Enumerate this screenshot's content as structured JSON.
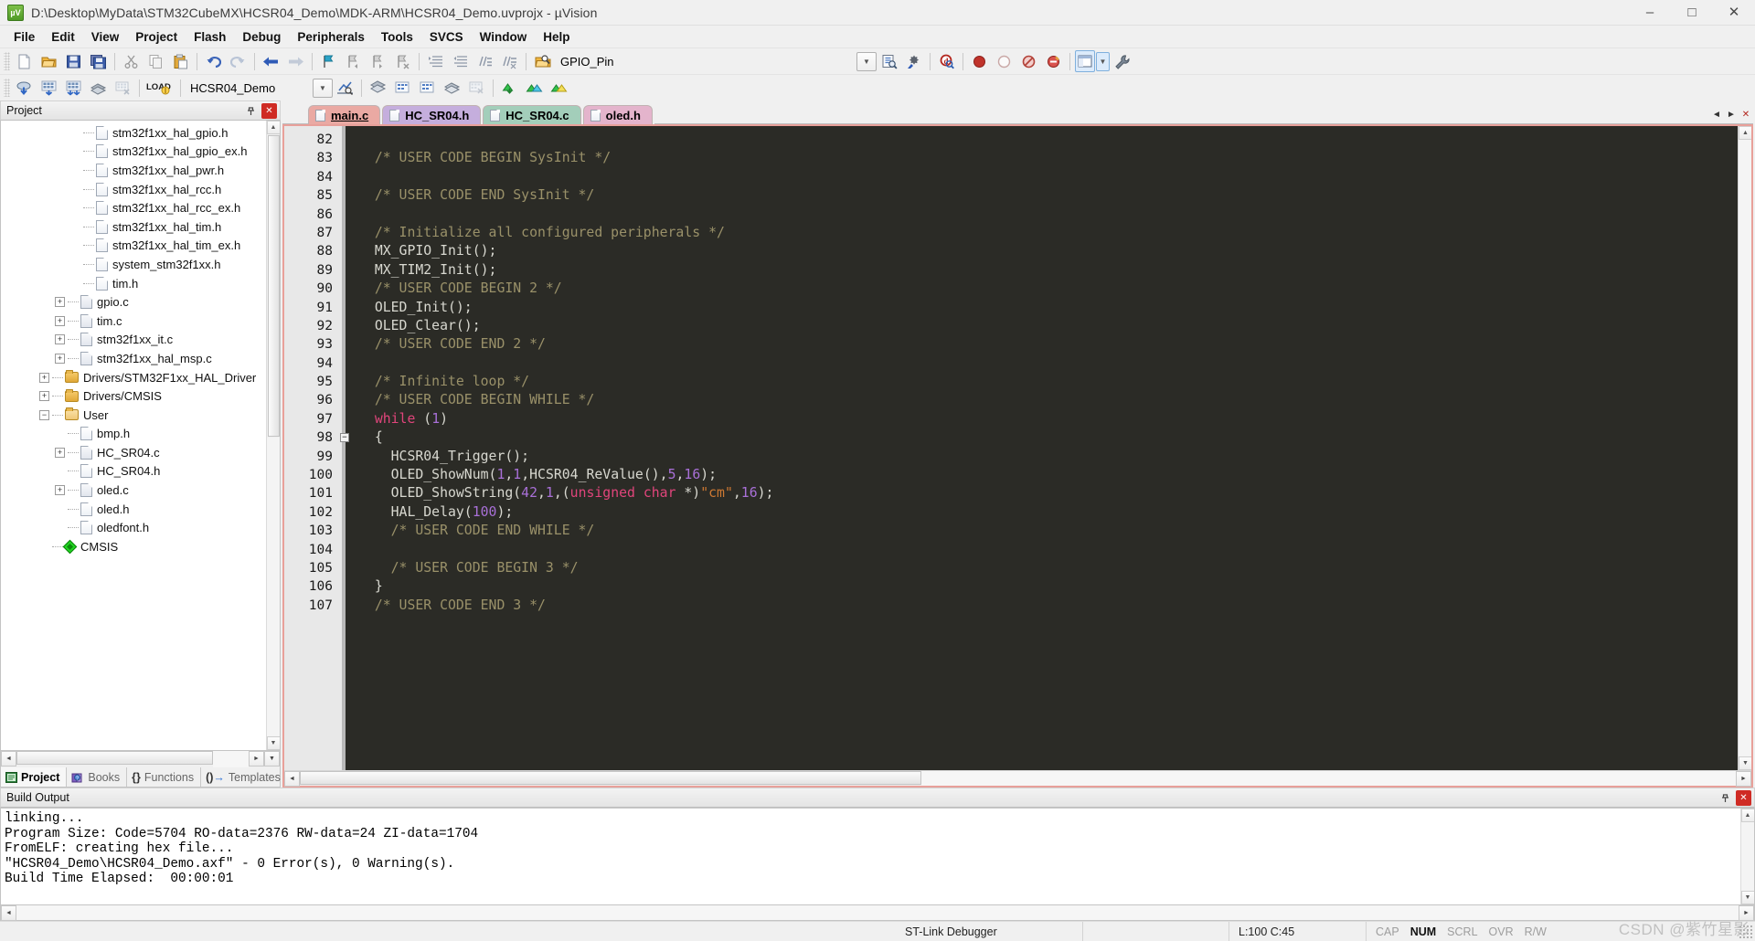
{
  "window": {
    "title": "D:\\Desktop\\MyData\\STM32CubeMX\\HCSR04_Demo\\MDK-ARM\\HCSR04_Demo.uvprojx - µVision",
    "app_icon_label": "µV",
    "minimize": "–",
    "maximize": "□",
    "close": "✕"
  },
  "menu": {
    "items": [
      "File",
      "Edit",
      "View",
      "Project",
      "Flash",
      "Debug",
      "Peripherals",
      "Tools",
      "SVCS",
      "Window",
      "Help"
    ]
  },
  "toolbar1": {
    "icons": [
      "new-file-icon",
      "open-file-icon",
      "save-icon",
      "save-all-icon",
      "cut-icon",
      "copy-icon",
      "paste-icon",
      "undo-icon",
      "redo-icon",
      "navigate-back-icon",
      "navigate-forward-icon",
      "bookmark-toggle-icon",
      "bookmark-prev-icon",
      "bookmark-next-icon",
      "bookmark-clear-icon",
      "indent-increase-icon",
      "indent-decrease-icon",
      "comment-icon",
      "uncomment-icon",
      "find-in-files-icon"
    ],
    "search_value": "GPIO_Pin",
    "search_placeholder": "",
    "right_icons": [
      "dropdown-arrow-icon",
      "browse-symbol-icon",
      "configure-icon",
      "debug-query-icon",
      "stop-icon",
      "circle-icon",
      "no-entry-icon",
      "warning-icon",
      "window-layout-icon",
      "layout-dropdown-icon",
      "configure-wrench-icon"
    ]
  },
  "toolbar2": {
    "icons": [
      "translate-icon",
      "build-target-icon",
      "rebuild-all-icon",
      "batch-build-icon",
      "stop-build-icon",
      "load-icon"
    ],
    "target_value": "HCSR04_Demo",
    "after_icons": [
      "target-options-icon",
      "manage-runtime-icon",
      "multi-project-icon",
      "book-icon",
      "insert-icon",
      "pack-installer-icon",
      "pack-green-icon",
      "pack-blue-icon",
      "pack-yellow-icon"
    ]
  },
  "project_panel": {
    "title": "Project",
    "pin": "📌",
    "close": "✕",
    "tree": [
      {
        "label": "stm32f1xx_hal_gpio.h",
        "indent": 4,
        "icon": "file-h-icon",
        "expander": "none"
      },
      {
        "label": "stm32f1xx_hal_gpio_ex.h",
        "indent": 4,
        "icon": "file-h-icon",
        "expander": "none"
      },
      {
        "label": "stm32f1xx_hal_pwr.h",
        "indent": 4,
        "icon": "file-h-icon",
        "expander": "none"
      },
      {
        "label": "stm32f1xx_hal_rcc.h",
        "indent": 4,
        "icon": "file-h-icon",
        "expander": "none"
      },
      {
        "label": "stm32f1xx_hal_rcc_ex.h",
        "indent": 4,
        "icon": "file-h-icon",
        "expander": "none"
      },
      {
        "label": "stm32f1xx_hal_tim.h",
        "indent": 4,
        "icon": "file-h-icon",
        "expander": "none"
      },
      {
        "label": "stm32f1xx_hal_tim_ex.h",
        "indent": 4,
        "icon": "file-h-icon",
        "expander": "none"
      },
      {
        "label": "system_stm32f1xx.h",
        "indent": 4,
        "icon": "file-h-icon",
        "expander": "none"
      },
      {
        "label": "tim.h",
        "indent": 4,
        "icon": "file-h-icon",
        "expander": "none"
      },
      {
        "label": "gpio.c",
        "indent": 3,
        "icon": "file-c-icon",
        "expander": "plus"
      },
      {
        "label": "tim.c",
        "indent": 3,
        "icon": "file-c-icon",
        "expander": "plus"
      },
      {
        "label": "stm32f1xx_it.c",
        "indent": 3,
        "icon": "file-c-icon",
        "expander": "plus"
      },
      {
        "label": "stm32f1xx_hal_msp.c",
        "indent": 3,
        "icon": "file-c-icon",
        "expander": "plus"
      },
      {
        "label": "Drivers/STM32F1xx_HAL_Driver",
        "indent": 2,
        "icon": "folder-icon",
        "expander": "plus"
      },
      {
        "label": "Drivers/CMSIS",
        "indent": 2,
        "icon": "folder-icon",
        "expander": "plus"
      },
      {
        "label": "User",
        "indent": 2,
        "icon": "folder-open-icon",
        "expander": "minus"
      },
      {
        "label": "bmp.h",
        "indent": 3,
        "icon": "file-h-icon",
        "expander": "none"
      },
      {
        "label": "HC_SR04.c",
        "indent": 3,
        "icon": "file-c-icon",
        "expander": "plus"
      },
      {
        "label": "HC_SR04.h",
        "indent": 3,
        "icon": "file-h-icon",
        "expander": "none"
      },
      {
        "label": "oled.c",
        "indent": 3,
        "icon": "file-c-icon",
        "expander": "plus"
      },
      {
        "label": "oled.h",
        "indent": 3,
        "icon": "file-h-icon",
        "expander": "none"
      },
      {
        "label": "oledfont.h",
        "indent": 3,
        "icon": "file-h-icon",
        "expander": "none"
      },
      {
        "label": "CMSIS",
        "indent": 2,
        "icon": "cmsis-diamond-icon",
        "expander": "none"
      }
    ],
    "tabs": [
      {
        "label": "Project",
        "icon": "project-icon",
        "active": true
      },
      {
        "label": "Books",
        "icon": "books-icon",
        "active": false
      },
      {
        "label": "Functions",
        "icon": "functions-icon",
        "active": false
      },
      {
        "label": "Templates",
        "icon": "templates-icon",
        "active": false
      }
    ]
  },
  "editor": {
    "tabs": [
      {
        "label": "main.c",
        "active": true,
        "color": "#eaa9a3"
      },
      {
        "label": "HC_SR04.h",
        "active": false,
        "color": "#c5aedd"
      },
      {
        "label": "HC_SR04.c",
        "active": false,
        "color": "#a3ceba"
      },
      {
        "label": "oled.h",
        "active": false,
        "color": "#e4b4cc"
      }
    ],
    "tab_scroll_left": "◄",
    "tab_scroll_right": "►",
    "tab_close": "✕",
    "first_line_number": 82,
    "lines": [
      {
        "n": 82,
        "fold": "",
        "tokens": []
      },
      {
        "n": 83,
        "fold": "",
        "tokens": [
          {
            "t": "  /* USER CODE BEGIN SysInit */",
            "c": "cm"
          }
        ]
      },
      {
        "n": 84,
        "fold": "",
        "tokens": []
      },
      {
        "n": 85,
        "fold": "",
        "tokens": [
          {
            "t": "  /* USER CODE END SysInit */",
            "c": "cm"
          }
        ]
      },
      {
        "n": 86,
        "fold": "",
        "tokens": []
      },
      {
        "n": 87,
        "fold": "",
        "tokens": [
          {
            "t": "  /* Initialize all configured peripherals */",
            "c": "cm"
          }
        ]
      },
      {
        "n": 88,
        "fold": "",
        "tokens": [
          {
            "t": "  MX_GPIO_Init();",
            "c": "pl"
          }
        ]
      },
      {
        "n": 89,
        "fold": "",
        "tokens": [
          {
            "t": "  MX_TIM2_Init();",
            "c": "pl"
          }
        ]
      },
      {
        "n": 90,
        "fold": "",
        "tokens": [
          {
            "t": "  /* USER CODE BEGIN 2 */",
            "c": "cm"
          }
        ]
      },
      {
        "n": 91,
        "fold": "",
        "tokens": [
          {
            "t": "  OLED_Init();",
            "c": "pl"
          }
        ]
      },
      {
        "n": 92,
        "fold": "",
        "tokens": [
          {
            "t": "  OLED_Clear();",
            "c": "pl"
          }
        ]
      },
      {
        "n": 93,
        "fold": "",
        "tokens": [
          {
            "t": "  /* USER CODE END 2 */",
            "c": "cm"
          }
        ]
      },
      {
        "n": 94,
        "fold": "",
        "tokens": []
      },
      {
        "n": 95,
        "fold": "",
        "tokens": [
          {
            "t": "  /* Infinite loop */",
            "c": "cm"
          }
        ]
      },
      {
        "n": 96,
        "fold": "",
        "tokens": [
          {
            "t": "  /* USER CODE BEGIN WHILE */",
            "c": "cm"
          }
        ]
      },
      {
        "n": 97,
        "fold": "",
        "tokens": [
          {
            "t": "  ",
            "c": "pl"
          },
          {
            "t": "while",
            "c": "kw"
          },
          {
            "t": " (",
            "c": "pl"
          },
          {
            "t": "1",
            "c": "num"
          },
          {
            "t": ")",
            "c": "pl"
          }
        ]
      },
      {
        "n": 98,
        "fold": "-",
        "tokens": [
          {
            "t": "  {",
            "c": "pl"
          }
        ]
      },
      {
        "n": 99,
        "fold": "",
        "tokens": [
          {
            "t": "    HCSR04_Trigger();",
            "c": "pl"
          }
        ]
      },
      {
        "n": 100,
        "fold": "",
        "tokens": [
          {
            "t": "    OLED_ShowNum(",
            "c": "pl"
          },
          {
            "t": "1",
            "c": "num"
          },
          {
            "t": ",",
            "c": "pl"
          },
          {
            "t": "1",
            "c": "num"
          },
          {
            "t": ",HCSR04_ReValue(),",
            "c": "pl"
          },
          {
            "t": "5",
            "c": "num"
          },
          {
            "t": ",",
            "c": "pl"
          },
          {
            "t": "16",
            "c": "num"
          },
          {
            "t": ");",
            "c": "pl"
          }
        ]
      },
      {
        "n": 101,
        "fold": "",
        "tokens": [
          {
            "t": "    OLED_ShowString(",
            "c": "pl"
          },
          {
            "t": "42",
            "c": "num"
          },
          {
            "t": ",",
            "c": "pl"
          },
          {
            "t": "1",
            "c": "num"
          },
          {
            "t": ",(",
            "c": "pl"
          },
          {
            "t": "unsigned char",
            "c": "kw"
          },
          {
            "t": " *)",
            "c": "pl"
          },
          {
            "t": "\"cm\"",
            "c": "str"
          },
          {
            "t": ",",
            "c": "pl"
          },
          {
            "t": "16",
            "c": "num"
          },
          {
            "t": ");",
            "c": "pl"
          }
        ]
      },
      {
        "n": 102,
        "fold": "",
        "tokens": [
          {
            "t": "    HAL_Delay(",
            "c": "pl"
          },
          {
            "t": "100",
            "c": "num"
          },
          {
            "t": ");",
            "c": "pl"
          }
        ]
      },
      {
        "n": 103,
        "fold": "",
        "tokens": [
          {
            "t": "    /* USER CODE END WHILE */",
            "c": "cm"
          }
        ]
      },
      {
        "n": 104,
        "fold": "",
        "tokens": []
      },
      {
        "n": 105,
        "fold": "",
        "tokens": [
          {
            "t": "    /* USER CODE BEGIN 3 */",
            "c": "cm"
          }
        ]
      },
      {
        "n": 106,
        "fold": "",
        "tokens": [
          {
            "t": "  }",
            "c": "pl"
          }
        ]
      },
      {
        "n": 107,
        "fold": "",
        "tokens": [
          {
            "t": "  /* USER CODE END 3 */",
            "c": "cm"
          }
        ]
      }
    ]
  },
  "build_output": {
    "title": "Build Output",
    "pin": "📌",
    "close": "✕",
    "lines": [
      "linking...",
      "Program Size: Code=5704 RO-data=2376 RW-data=24 ZI-data=1704",
      "FromELF: creating hex file...",
      "\"HCSR04_Demo\\HCSR04_Demo.axf\" - 0 Error(s), 0 Warning(s).",
      "Build Time Elapsed:  00:00:01"
    ]
  },
  "statusbar": {
    "debugger": "ST-Link Debugger",
    "cursor": "L:100 C:45",
    "indicators": [
      {
        "label": "CAP",
        "on": false
      },
      {
        "label": "NUM",
        "on": true
      },
      {
        "label": "SCRL",
        "on": false
      },
      {
        "label": "OVR",
        "on": false
      },
      {
        "label": "R/W",
        "on": false
      }
    ],
    "watermark": "CSDN @紫竹星影"
  },
  "colors": {
    "accent": "#cf2b24",
    "editor_bg": "#2b2b26",
    "gutter_bg": "#e8e8e8",
    "comment": "#9a9169",
    "keyword": "#e0457b",
    "number": "#a970d8",
    "string": "#cc7832",
    "chrome": "#f0f0f0"
  }
}
